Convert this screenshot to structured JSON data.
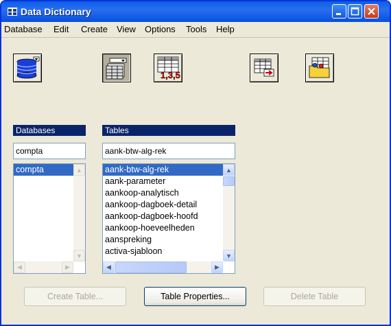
{
  "window": {
    "title": "Data Dictionary"
  },
  "menu": [
    "Database",
    "Edit",
    "Create",
    "View",
    "Options",
    "Tools",
    "Help"
  ],
  "databases": {
    "label": "Databases",
    "current": "compta",
    "items": [
      "compta"
    ]
  },
  "tables": {
    "label": "Tables",
    "current": "aank-btw-alg-rek",
    "items": [
      "aank-btw-alg-rek",
      "aank-parameter",
      "aankoop-analytisch",
      "aankoop-dagboek-detail",
      "aankoop-dagboek-hoofd",
      "aankoop-hoeveelheden",
      "aanspreking",
      "activa-sjabloon"
    ]
  },
  "buttons": {
    "create_table": "Create Table...",
    "table_properties": "Table Properties...",
    "delete_table": "Delete Table"
  },
  "colors": {
    "selection": "#316ac5",
    "label_bar": "#0a246a",
    "titlebar": "#0a5fe8"
  }
}
